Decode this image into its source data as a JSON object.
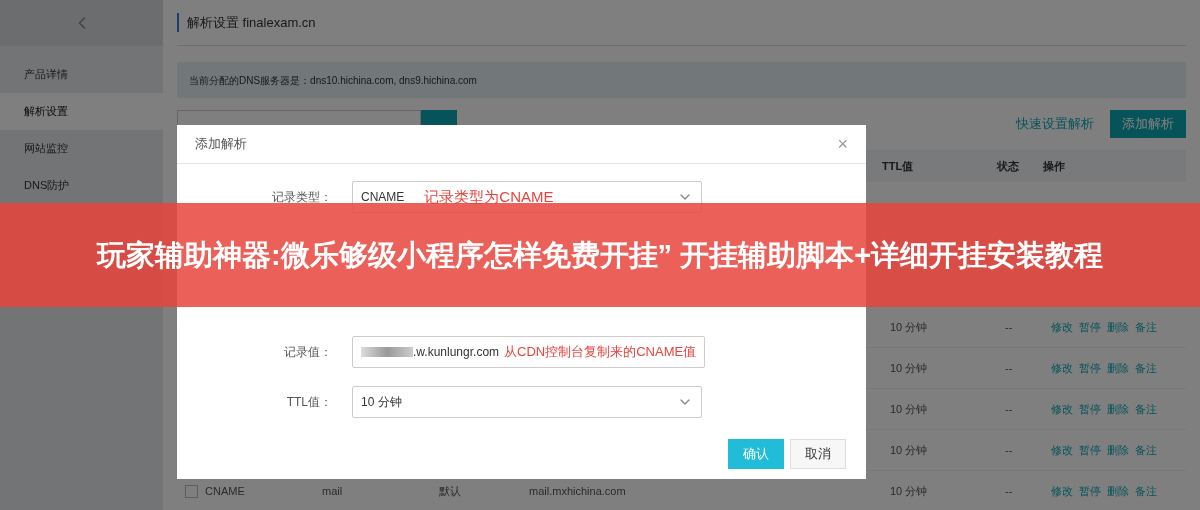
{
  "sidebar": {
    "items": [
      {
        "label": "产品详情",
        "selected": false
      },
      {
        "label": "解析设置",
        "selected": true
      },
      {
        "label": "网站监控",
        "selected": false
      },
      {
        "label": "DNS防护",
        "selected": false
      }
    ]
  },
  "header": {
    "title": "解析设置 finalexam.cn"
  },
  "info_bar": "当前分配的DNS服务器是：dns10.hichina.com, dns9.hichina.com",
  "quick_setup_link": "快速设置解析",
  "add_button": "添加解析",
  "table": {
    "columns": [
      "TTL值",
      "状态",
      "操作"
    ],
    "rows": [
      {
        "ttl": "10 分钟",
        "status": "--",
        "actions": [
          "修改",
          "暂停",
          "删除",
          "备注"
        ]
      },
      {
        "ttl": "10 分钟",
        "status": "--",
        "actions": [
          "修改",
          "暂停",
          "删除",
          "备注"
        ]
      },
      {
        "ttl": "10 分钟",
        "status": "--",
        "actions": [
          "修改",
          "暂停",
          "删除",
          "备注"
        ]
      },
      {
        "ttl": "10 分钟",
        "status": "--",
        "actions": [
          "修改",
          "暂停",
          "删除",
          "备注"
        ]
      },
      {
        "checked": false,
        "type": "CNAME",
        "host": "mail",
        "line": "默认",
        "value": "mail.mxhichina.com",
        "ttl": "10 分钟",
        "status": "--",
        "actions": [
          "修改",
          "暂停",
          "删除",
          "备注"
        ]
      }
    ]
  },
  "dialog": {
    "title": "添加解析",
    "close": "×",
    "fields": [
      {
        "label": "记录类型：",
        "kind": "select",
        "value": "CNAME",
        "annotation": "记录类型为CNAME"
      },
      {
        "label": "记录值：",
        "kind": "input",
        "value": ".w.kunlungr.com",
        "blurred": true,
        "annotation": "从CDN控制台复制来的CNAME值"
      },
      {
        "label": "TTL值：",
        "kind": "select",
        "value": "10 分钟"
      }
    ],
    "buttons": [
      {
        "label": "确认",
        "kind": "primary"
      },
      {
        "label": "取消",
        "kind": "secondary"
      }
    ]
  },
  "banner": "玩家辅助神器:微乐够级小程序怎样免费开挂” 开挂辅助脚本+详细开挂安装教程"
}
